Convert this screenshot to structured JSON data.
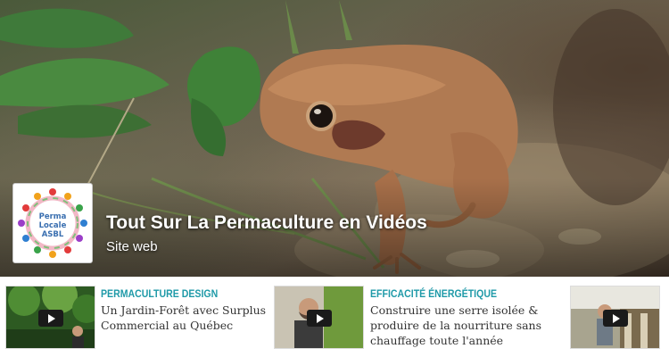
{
  "page": {
    "name": "Tout Sur La Permaculture en Vidéos",
    "category": "Site web",
    "avatar_text": [
      "Perma",
      "Locale",
      "ASBL"
    ]
  },
  "colors": {
    "kicker": "#1f9aa8",
    "title_text": "#333333",
    "cover_text": "#ffffff"
  },
  "articles": [
    {
      "kicker": "PERMACULTURE DESIGN",
      "title": [
        "Un Jardin-Forêt avec Surplus",
        "Commercial au Québec"
      ]
    },
    {
      "kicker": "EFFICACITÉ ÉNERGÉTIQUE",
      "title": [
        "Construire une serre isolée &",
        "produire de la nourriture sans",
        "chauffage toute l'année"
      ]
    },
    {
      "kicker": "",
      "title": []
    }
  ],
  "icons": [
    "play-icon",
    "play-icon",
    "play-icon"
  ]
}
